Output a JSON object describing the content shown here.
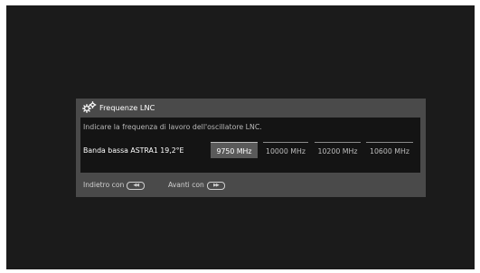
{
  "dialog": {
    "icon": "gears-icon",
    "title": "Frequenze LNC",
    "instruction": "Indicare la frequenza di lavoro dell'oscillatore LNC.",
    "setting": {
      "label": "Banda bassa ASTRA1 19,2°E",
      "options": [
        "9750 MHz",
        "10000 MHz",
        "10200 MHz",
        "10600 MHz"
      ],
      "selected": "9750 MHz"
    }
  },
  "footer": {
    "back_label": "Indietro con",
    "back_icon": "rewind-button-icon",
    "next_label": "Avanti con",
    "next_icon": "fast-forward-button-icon"
  }
}
